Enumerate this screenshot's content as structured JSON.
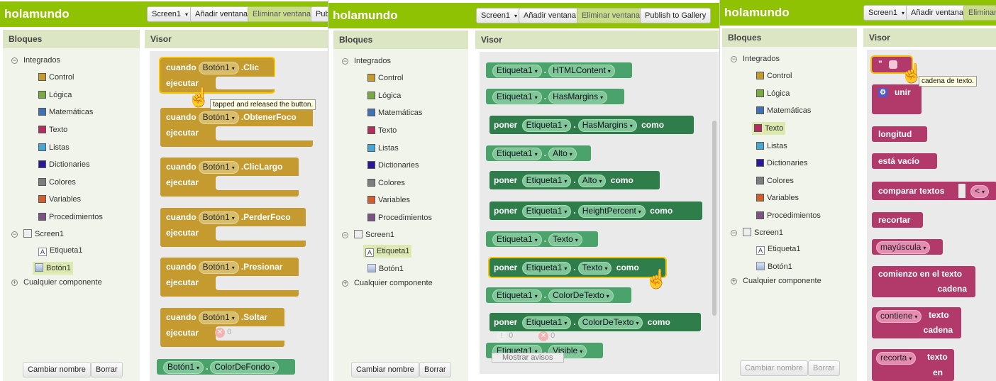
{
  "panels": [
    {
      "app_title": "holamundo",
      "screen_select": "Screen1",
      "add_screen": "Añadir ventana",
      "remove_screen": "Eliminar ventana",
      "publish": "Publish to Gallery",
      "bloques_header": "Bloques",
      "visor_header": "Visor",
      "tree": {
        "integrados": "Integrados",
        "items": [
          "Control",
          "Lógica",
          "Matemáticas",
          "Texto",
          "Listas",
          "Dictionaries",
          "Colores",
          "Variables",
          "Procedimientos"
        ],
        "screen": "Screen1",
        "components": [
          "Etiqueta1",
          "Botón1"
        ],
        "any": "Cualquier componente"
      },
      "rename_button": "Cambiar nombre",
      "delete_button": "Borrar",
      "tooltip": "tapped and released the button.",
      "blocks": {
        "when": "cuando",
        "do": "ejecutar",
        "component": "Botón1",
        "events": [
          ".Clic",
          ".ObtenerFoco",
          ".ClicLargo",
          ".PerderFoco",
          ".Presionar",
          ".Soltar"
        ],
        "bottom_component": "Botón1",
        "bottom_property": "ColorDeFondo",
        "badge_count": "0"
      }
    },
    {
      "app_title": "holamundo",
      "screen_select": "Screen1",
      "add_screen": "Añadir ventana",
      "remove_screen": "Eliminar ventana",
      "publish": "Publish to Gallery",
      "bloques_header": "Bloques",
      "visor_header": "Visor",
      "tree": {
        "integrados": "Integrados",
        "items": [
          "Control",
          "Lógica",
          "Matemáticas",
          "Texto",
          "Listas",
          "Dictionaries",
          "Colores",
          "Variables",
          "Procedimientos"
        ],
        "screen": "Screen1",
        "components": [
          "Etiqueta1",
          "Botón1"
        ],
        "any": "Cualquier componente"
      },
      "rename_button": "Cambiar nombre",
      "delete_button": "Borrar",
      "blocks": {
        "set_word": "poner",
        "as_word": "como",
        "component": "Etiqueta1",
        "rows": [
          {
            "kind": "get",
            "prop": "HTMLContent"
          },
          {
            "kind": "get",
            "prop": "HasMargins"
          },
          {
            "kind": "set",
            "prop": "HasMargins"
          },
          {
            "kind": "get",
            "prop": "Alto"
          },
          {
            "kind": "set",
            "prop": "Alto"
          },
          {
            "kind": "set",
            "prop": "HeightPercent"
          },
          {
            "kind": "get",
            "prop": "Texto"
          },
          {
            "kind": "set",
            "prop": "Texto"
          },
          {
            "kind": "get",
            "prop": "ColorDeTexto"
          },
          {
            "kind": "set",
            "prop": "ColorDeTexto"
          },
          {
            "kind": "get",
            "prop": "Visible"
          }
        ],
        "badge_count": "0",
        "show_warnings": "Mostrar avisos"
      }
    },
    {
      "app_title": "holamundo",
      "screen_select": "Screen1",
      "add_screen": "Añadir ventana",
      "remove_screen": "Eliminar",
      "bloques_header": "Bloques",
      "visor_header": "Visor",
      "tree": {
        "integrados": "Integrados",
        "items": [
          "Control",
          "Lógica",
          "Matemáticas",
          "Texto",
          "Listas",
          "Dictionaries",
          "Colores",
          "Variables",
          "Procedimientos"
        ],
        "screen": "Screen1",
        "components": [
          "Etiqueta1",
          "Botón1"
        ],
        "any": "Cualquier componente"
      },
      "rename_button": "Cambiar nombre",
      "delete_button": "Borrar",
      "tooltip": "cadena de texto.",
      "blocks": {
        "string_quote": "\" ",
        "join": "unir",
        "length": "longitud",
        "is_empty": "está vacío",
        "compare": "comparar textos",
        "compare_op": "<",
        "trim": "recortar",
        "upcase": "mayúscula",
        "starts_at_1": "comienzo en el texto",
        "starts_at_2": "cadena",
        "contains": "contiene",
        "contains_text": "texto",
        "contains_piece": "cadena",
        "split": "recorta",
        "split_text": "texto",
        "split_at": "en"
      }
    }
  ],
  "colors": {
    "topbar": "#8fc202",
    "control": "#c59a2f",
    "logica": "#77ab41",
    "matematicas": "#3f71b5",
    "texto": "#b32d5e",
    "listas": "#49a6d4",
    "dictionaries": "#2d1799",
    "colores": "#7d7d7d",
    "variables": "#d05f2d",
    "procedimientos": "#7c5385"
  }
}
